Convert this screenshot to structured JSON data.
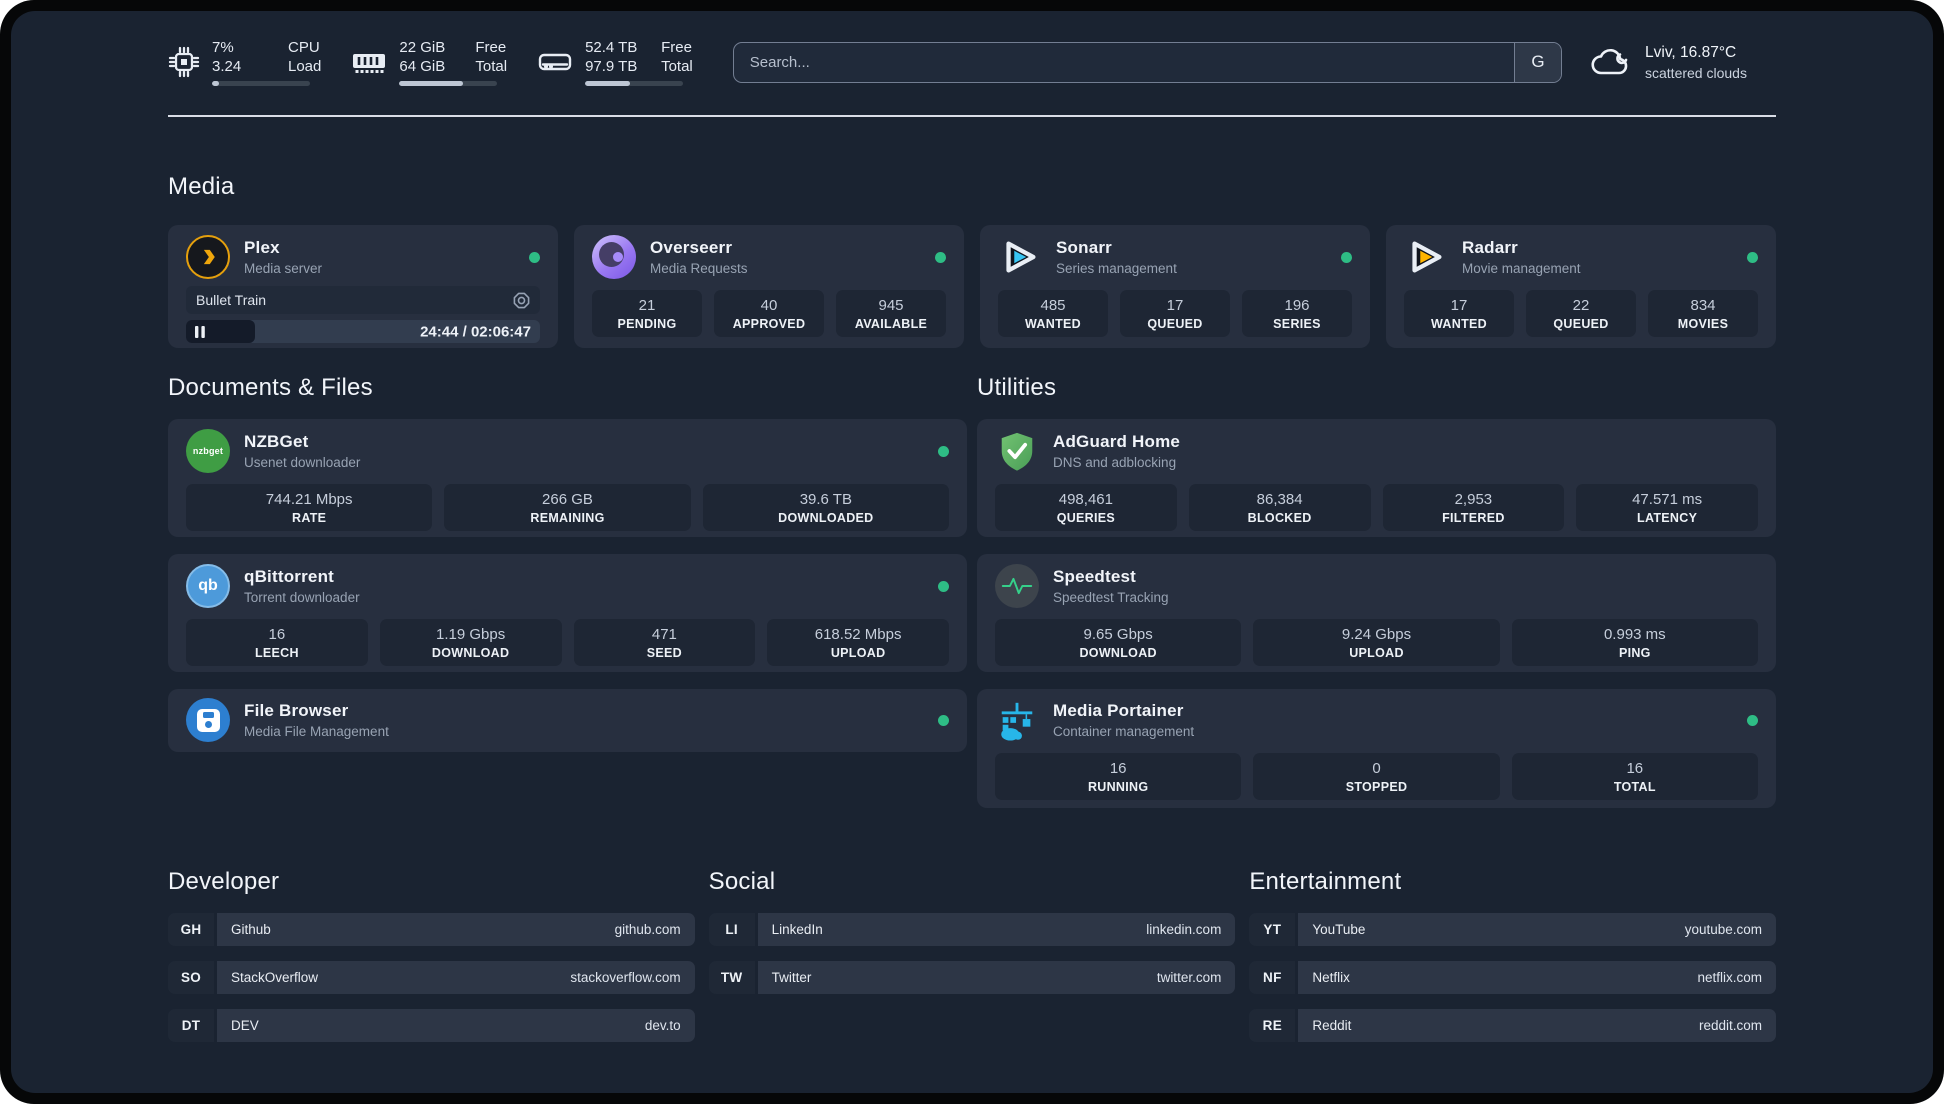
{
  "header": {
    "stats": {
      "cpu": {
        "value_top": "7%",
        "value_bottom": "3.24",
        "label_top": "CPU",
        "label_bottom": "Load",
        "progress": 7
      },
      "ram": {
        "value_top": "22 GiB",
        "value_bottom": "64 GiB",
        "label_top": "Free",
        "label_bottom": "Total",
        "progress": 65
      },
      "disk": {
        "value_top": "52.4 TB",
        "value_bottom": "97.9 TB",
        "label_top": "Free",
        "label_bottom": "Total",
        "progress": 46
      }
    },
    "search": {
      "placeholder": "Search...",
      "engine_button": "G"
    },
    "weather": {
      "location_temp": "Lviv, 16.87°C",
      "condition": "scattered clouds"
    }
  },
  "sections": {
    "media": "Media",
    "documents": "Documents & Files",
    "utilities": "Utilities"
  },
  "apps": {
    "plex": {
      "name": "Plex",
      "subtitle": "Media server",
      "online": true,
      "player": {
        "title": "Bullet Train",
        "time": "24:44 / 02:06:47",
        "progress": 19.5
      }
    },
    "overseerr": {
      "name": "Overseerr",
      "subtitle": "Media Requests",
      "online": true,
      "stats": [
        {
          "value": "21",
          "label": "PENDING"
        },
        {
          "value": "40",
          "label": "APPROVED"
        },
        {
          "value": "945",
          "label": "AVAILABLE"
        }
      ]
    },
    "sonarr": {
      "name": "Sonarr",
      "subtitle": "Series management",
      "online": true,
      "stats": [
        {
          "value": "485",
          "label": "WANTED"
        },
        {
          "value": "17",
          "label": "QUEUED"
        },
        {
          "value": "196",
          "label": "SERIES"
        }
      ]
    },
    "radarr": {
      "name": "Radarr",
      "subtitle": "Movie management",
      "online": true,
      "stats": [
        {
          "value": "17",
          "label": "WANTED"
        },
        {
          "value": "22",
          "label": "QUEUED"
        },
        {
          "value": "834",
          "label": "MOVIES"
        }
      ]
    },
    "nzbget": {
      "name": "NZBGet",
      "subtitle": "Usenet downloader",
      "online": true,
      "stats": [
        {
          "value": "744.21 Mbps",
          "label": "RATE"
        },
        {
          "value": "266 GB",
          "label": "REMAINING"
        },
        {
          "value": "39.6 TB",
          "label": "DOWNLOADED"
        }
      ]
    },
    "qbittorrent": {
      "name": "qBittorrent",
      "subtitle": "Torrent downloader",
      "online": true,
      "stats": [
        {
          "value": "16",
          "label": "LEECH"
        },
        {
          "value": "1.19 Gbps",
          "label": "DOWNLOAD"
        },
        {
          "value": "471",
          "label": "SEED"
        },
        {
          "value": "618.52 Mbps",
          "label": "UPLOAD"
        }
      ]
    },
    "filebrowser": {
      "name": "File Browser",
      "subtitle": "Media File Management",
      "online": true
    },
    "adguard": {
      "name": "AdGuard Home",
      "subtitle": "DNS and adblocking",
      "stats": [
        {
          "value": "498,461",
          "label": "QUERIES"
        },
        {
          "value": "86,384",
          "label": "BLOCKED"
        },
        {
          "value": "2,953",
          "label": "FILTERED"
        },
        {
          "value": "47.571 ms",
          "label": "LATENCY"
        }
      ]
    },
    "speedtest": {
      "name": "Speedtest",
      "subtitle": "Speedtest Tracking",
      "stats": [
        {
          "value": "9.65 Gbps",
          "label": "DOWNLOAD"
        },
        {
          "value": "9.24 Gbps",
          "label": "UPLOAD"
        },
        {
          "value": "0.993 ms",
          "label": "PING"
        }
      ]
    },
    "portainer": {
      "name": "Media Portainer",
      "subtitle": "Container management",
      "online": true,
      "stats": [
        {
          "value": "16",
          "label": "RUNNING"
        },
        {
          "value": "0",
          "label": "STOPPED"
        },
        {
          "value": "16",
          "label": "TOTAL"
        }
      ]
    }
  },
  "bookmarks": {
    "developer": {
      "title": "Developer",
      "links": [
        {
          "abbr": "GH",
          "name": "Github",
          "url": "github.com"
        },
        {
          "abbr": "SO",
          "name": "StackOverflow",
          "url": "stackoverflow.com"
        },
        {
          "abbr": "DT",
          "name": "DEV",
          "url": "dev.to"
        }
      ]
    },
    "social": {
      "title": "Social",
      "links": [
        {
          "abbr": "LI",
          "name": "LinkedIn",
          "url": "linkedin.com"
        },
        {
          "abbr": "TW",
          "name": "Twitter",
          "url": "twitter.com"
        }
      ]
    },
    "entertainment": {
      "title": "Entertainment",
      "links": [
        {
          "abbr": "YT",
          "name": "YouTube",
          "url": "youtube.com"
        },
        {
          "abbr": "NF",
          "name": "Netflix",
          "url": "netflix.com"
        },
        {
          "abbr": "RE",
          "name": "Reddit",
          "url": "reddit.com"
        }
      ]
    }
  },
  "colors": {
    "background": "#1a2331",
    "card": "#272f3f",
    "tile": "#1e2634",
    "status_online": "#2ebd85",
    "plex_orange": "#e5a00d",
    "sonarr_blue": "#38c6f4",
    "radarr_yellow": "#ffb400",
    "nzbget_green": "#3f9d44",
    "qbittorrent_blue": "#4d9ada",
    "filebrowser_blue": "#2d7fd0",
    "adguard_green": "#5cb464",
    "speedtest_pulse": "#35d08a",
    "portainer_cyan": "#27b6e9"
  }
}
